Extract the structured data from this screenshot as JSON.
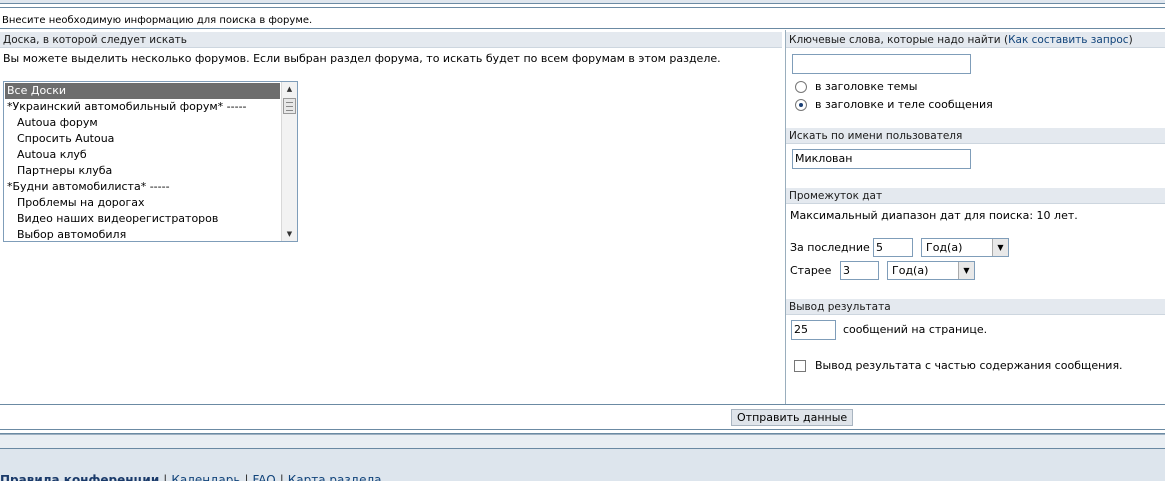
{
  "intro": "Внесите необходимую информацию для поиска в форуме.",
  "board": {
    "header": "Доска, в которой следует искать",
    "description": "Вы можете выделить несколько форумов. Если выбран раздел форума, то искать будет по всем форумам в этом разделе.",
    "items": [
      {
        "label": "Все Доски",
        "kind": "selected"
      },
      {
        "label": "*Украинский автомобильный форум* -----",
        "kind": "cat"
      },
      {
        "label": "Autoua форум",
        "kind": "sub"
      },
      {
        "label": "Спросить Autoua",
        "kind": "sub"
      },
      {
        "label": "Autoua клуб",
        "kind": "sub"
      },
      {
        "label": "Партнеры клуба",
        "kind": "sub"
      },
      {
        "label": "*Будни автомобилиста* -----",
        "kind": "cat"
      },
      {
        "label": "Проблемы на дорогах",
        "kind": "sub"
      },
      {
        "label": "Видео наших видеорегистраторов",
        "kind": "sub"
      },
      {
        "label": "Выбор автомобиля",
        "kind": "sub"
      }
    ]
  },
  "keywords": {
    "header": "Ключевые слова, которые надо найти",
    "help_open": "(",
    "help_link": "Как составить запрос",
    "help_close": ")",
    "value": "",
    "option_title": "в заголовке темы",
    "option_title_body": "в заголовке и теле сообщения"
  },
  "user_search": {
    "header": "Искать по имени пользователя",
    "value": "Миклован"
  },
  "dates": {
    "header": "Промежуток дат",
    "note": "Максимальный диапазон дат для поиска: 10 лет.",
    "last_label": "За последние",
    "last_value": "5",
    "last_unit": "Год(а)",
    "older_label": "Старее",
    "older_value": "3",
    "older_unit": "Год(а)"
  },
  "results": {
    "header": "Вывод результата",
    "per_page_value": "25",
    "per_page_label": "сообщений на странице.",
    "excerpt_label": "Вывод результата с частью содержания сообщения."
  },
  "submit_label": "Отправить данные",
  "footer": {
    "rules": "Правила конференции",
    "sep": "|",
    "calendar": "Календарь",
    "faq": "FAQ",
    "map": "Карта раздела"
  },
  "icons": {
    "scroll_up": "▲",
    "scroll_down": "▼",
    "dropdown": "▼"
  }
}
